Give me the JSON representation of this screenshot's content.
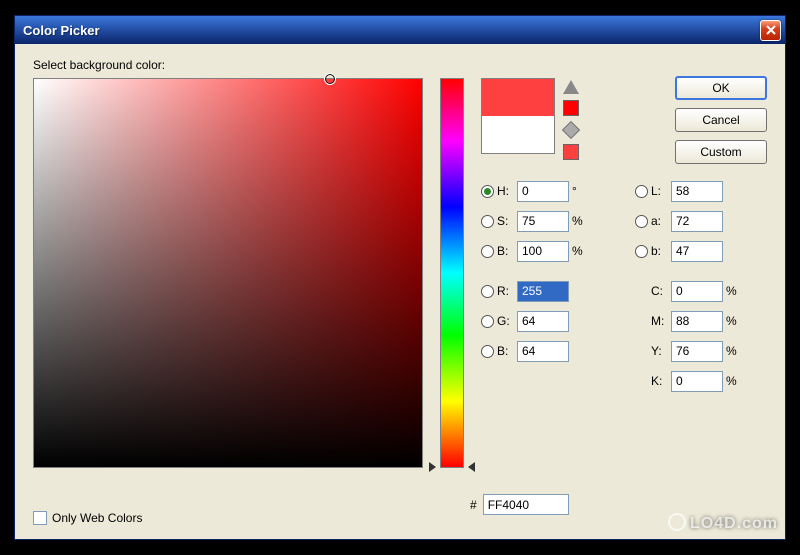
{
  "titlebar": {
    "title": "Color Picker"
  },
  "prompt": "Select background color:",
  "buttons": {
    "ok": "OK",
    "cancel": "Cancel",
    "custom": "Custom"
  },
  "hsb": {
    "h_label": "H:",
    "h_value": "0",
    "h_unit": "°",
    "s_label": "S:",
    "s_value": "75",
    "s_unit": "%",
    "b_label": "B:",
    "b_value": "100",
    "b_unit": "%"
  },
  "lab": {
    "l_label": "L:",
    "l_value": "58",
    "a_label": "a:",
    "a_value": "72",
    "b_label": "b:",
    "b_value": "47"
  },
  "rgb": {
    "r_label": "R:",
    "r_value": "255",
    "g_label": "G:",
    "g_value": "64",
    "b_label": "B:",
    "b_value": "64"
  },
  "cmyk": {
    "c_label": "C:",
    "c_value": "0",
    "c_unit": "%",
    "m_label": "M:",
    "m_value": "88",
    "m_unit": "%",
    "y_label": "Y:",
    "y_value": "76",
    "y_unit": "%",
    "k_label": "K:",
    "k_value": "0",
    "k_unit": "%"
  },
  "hex": {
    "label": "#",
    "value": "FF4040"
  },
  "only_web_label": "Only Web Colors",
  "swatch": {
    "new_color": "#FF4040",
    "old_color": "#FFFFFF",
    "mini1": "#FF0000",
    "mini2": "#FF4040"
  },
  "watermark": "LO4D.com"
}
